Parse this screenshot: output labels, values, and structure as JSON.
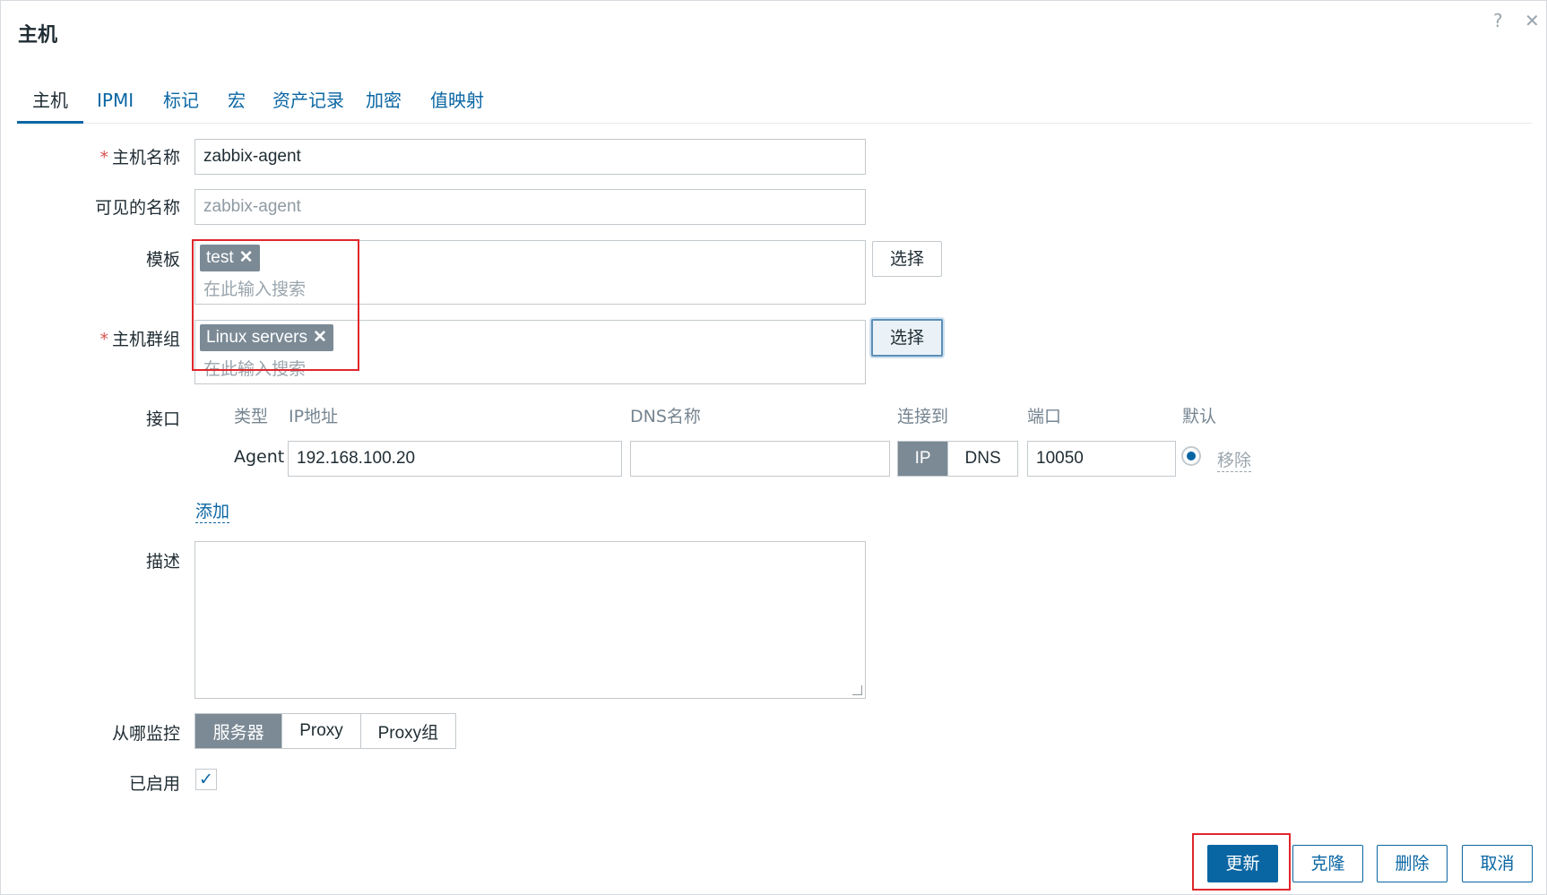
{
  "header": {
    "title": "主机",
    "help_icon": "?",
    "close_icon": "✕"
  },
  "tabs": [
    {
      "label": "主机"
    },
    {
      "label": "IPMI"
    },
    {
      "label": "标记"
    },
    {
      "label": "宏"
    },
    {
      "label": "资产记录"
    },
    {
      "label": "加密"
    },
    {
      "label": "值映射"
    }
  ],
  "form": {
    "host_name": {
      "label": "主机名称",
      "value": "zabbix-agent",
      "required": true
    },
    "visible_name": {
      "label": "可见的名称",
      "placeholder": "zabbix-agent"
    },
    "templates": {
      "label": "模板",
      "chips": [
        "test"
      ],
      "placeholder": "在此输入搜索",
      "select_label": "选择"
    },
    "host_groups": {
      "label": "主机群组",
      "chips": [
        "Linux servers"
      ],
      "placeholder": "在此输入搜索",
      "select_label": "选择",
      "required": true
    },
    "interfaces": {
      "label": "接口",
      "columns": [
        "类型",
        "IP地址",
        "DNS名称",
        "连接到",
        "端口",
        "默认"
      ],
      "row": {
        "type": "Agent",
        "ip": "192.168.100.20",
        "dns": "",
        "connect_options": [
          "IP",
          "DNS"
        ],
        "connect_selected": "IP",
        "port": "10050",
        "remove_label": "移除"
      },
      "add_label": "添加"
    },
    "description": {
      "label": "描述",
      "value": ""
    },
    "monitored_by": {
      "label": "从哪监控",
      "options": [
        "服务器",
        "Proxy",
        "Proxy组"
      ],
      "selected": "服务器"
    },
    "enabled": {
      "label": "已启用",
      "checked": true
    }
  },
  "footer": {
    "update": "更新",
    "clone": "克隆",
    "delete": "删除",
    "cancel": "取消"
  },
  "colors": {
    "accent": "#0a66a3",
    "chip": "#7b8a95",
    "annotation": "#e0262b"
  }
}
